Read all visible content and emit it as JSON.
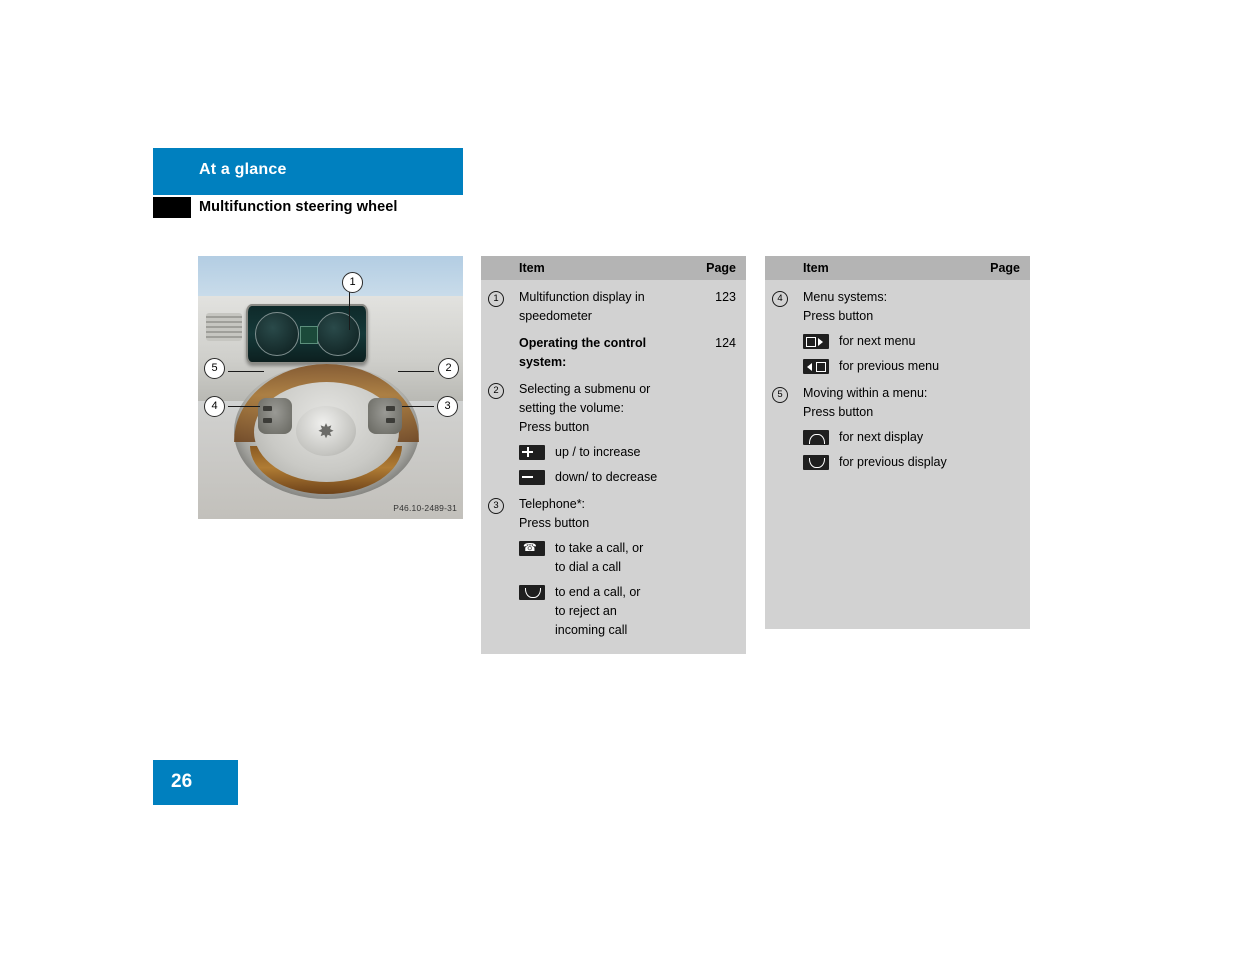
{
  "header": {
    "title": "At a glance",
    "subtitle": "Multifunction steering wheel"
  },
  "figure": {
    "caption": "P46.10-2489-31",
    "callouts": [
      "1",
      "5",
      "2",
      "4",
      "3"
    ]
  },
  "tables": [
    {
      "id": "left-table",
      "headers": {
        "item": "Item",
        "page": "Page"
      },
      "rows": [
        {
          "num": "1",
          "item": "Multifunction display in\nspeedometer",
          "page": "123",
          "bold": false
        },
        {
          "num": "",
          "item": "Operating the control\nsystem:",
          "page": "124",
          "bold": true
        },
        {
          "num": "2",
          "item": "Selecting a submenu or\nsetting the volume:\nPress button",
          "page": "",
          "bold": false,
          "subitems": [
            {
              "icon": "plus-button-icon",
              "text": "up / to increase"
            },
            {
              "icon": "minus-button-icon",
              "text": "down/ to decrease"
            }
          ]
        },
        {
          "num": "3",
          "item": "Telephone*:\nPress button",
          "page": "",
          "bold": false,
          "subitems": [
            {
              "icon": "phone-offhook-icon",
              "text": "to take a call, or\nto dial a call"
            },
            {
              "icon": "phone-onhook-icon",
              "text": "to end a call, or\nto reject an\nincoming call"
            }
          ]
        }
      ]
    },
    {
      "id": "right-table",
      "headers": {
        "item": "Item",
        "page": "Page"
      },
      "rows": [
        {
          "num": "4",
          "item": "Menu systems:\nPress button",
          "page": "",
          "bold": false,
          "subitems": [
            {
              "icon": "next-menu-icon",
              "text": "for next menu"
            },
            {
              "icon": "previous-menu-icon",
              "text": "for previous menu"
            }
          ]
        },
        {
          "num": "5",
          "item": "Moving within a menu:\nPress button",
          "page": "",
          "bold": false,
          "subitems": [
            {
              "icon": "next-display-icon",
              "text": "for next display"
            },
            {
              "icon": "previous-display-icon",
              "text": "for previous display"
            }
          ]
        }
      ]
    }
  ],
  "footer": {
    "page_number": "26"
  },
  "colors": {
    "accent": "#0080bf",
    "table_header": "#b4b4b4",
    "table_body": "#d2d2d2"
  }
}
